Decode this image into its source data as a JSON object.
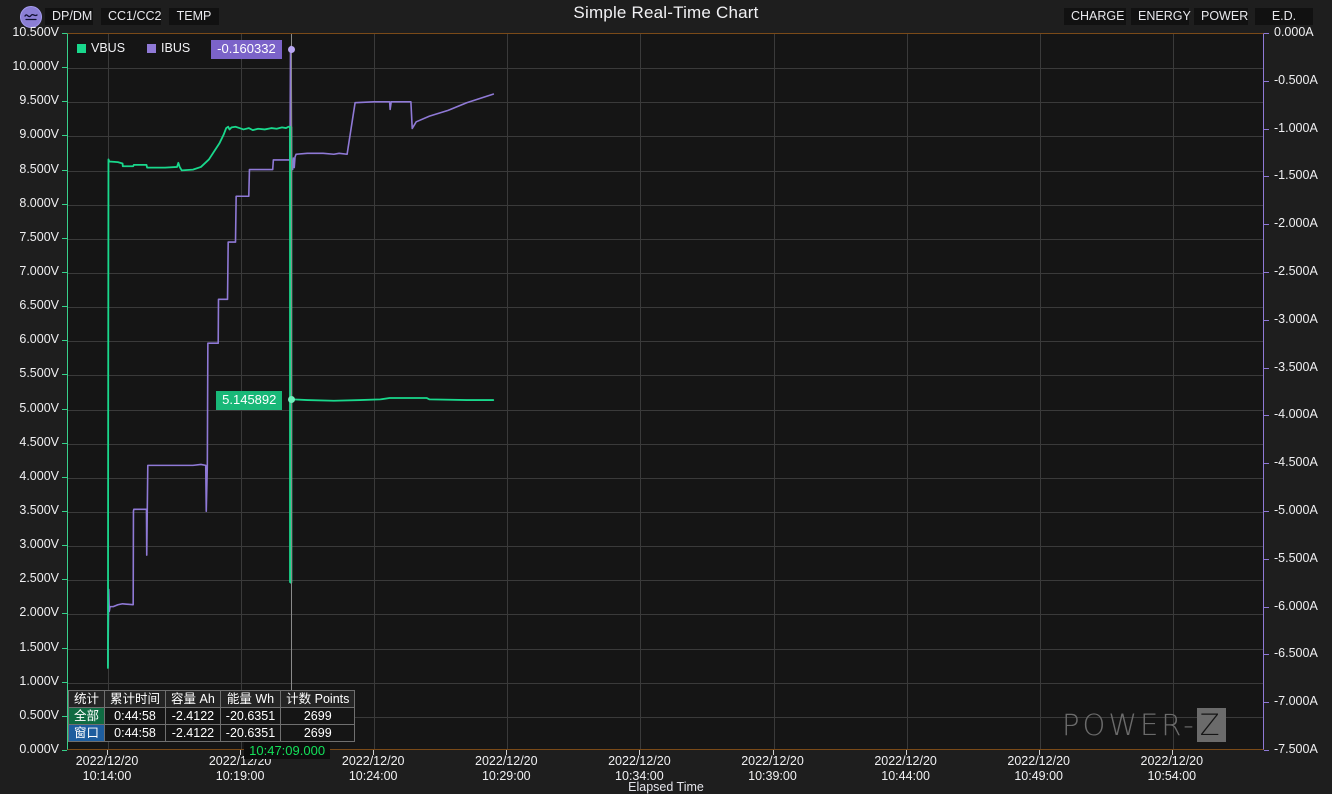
{
  "window": {
    "title": "Simple Real-Time Chart",
    "logo_icon": "power-z-wave-icon"
  },
  "toolbar": {
    "left_buttons": [
      {
        "id": "dpdm",
        "label": "DP/DM"
      },
      {
        "id": "cc",
        "label": "CC1/CC2"
      },
      {
        "id": "temp",
        "label": "TEMP"
      }
    ],
    "right_buttons": [
      {
        "id": "charge",
        "label": "CHARGE"
      },
      {
        "id": "energy",
        "label": "ENERGY"
      },
      {
        "id": "power",
        "label": "POWER"
      },
      {
        "id": "ed",
        "label": "E.D."
      }
    ]
  },
  "legend": [
    {
      "label": "VBUS",
      "color": "#19d88c"
    },
    {
      "label": "IBUS",
      "color": "#8f79d6"
    }
  ],
  "cursor": {
    "time_label": "10:47:09.000",
    "ibus_value": "-0.160332",
    "vbus_value": "5.145892"
  },
  "stats": {
    "headers": [
      "统计",
      "累计时间",
      "容量 Ah",
      "能量 Wh",
      "计数 Points"
    ],
    "rows": [
      {
        "label": "全部",
        "elapsed": "0:44:58",
        "capacity": "-2.4122",
        "energy": "-20.6351",
        "points": "2699"
      },
      {
        "label": "窗口",
        "elapsed": "0:44:58",
        "capacity": "-2.4122",
        "energy": "-20.6351",
        "points": "2699"
      }
    ]
  },
  "watermark": {
    "text_main": "POWER-",
    "text_box": "Z"
  },
  "chart_data": {
    "type": "line",
    "title": "Simple Real-Time Chart",
    "xlabel": "Elapsed Time",
    "grid": true,
    "legend_position": "top-left",
    "x_ticks": [
      "2022/12/20\n10:14:00",
      "2022/12/20\n10:19:00",
      "2022/12/20\n10:24:00",
      "2022/12/20\n10:29:00",
      "2022/12/20\n10:34:00",
      "2022/12/20\n10:39:00",
      "2022/12/20\n10:44:00",
      "2022/12/20\n10:49:00",
      "2022/12/20\n10:54:00"
    ],
    "x_tick_dates": [
      "2022/12/20",
      "2022/12/20",
      "2022/12/20",
      "2022/12/20",
      "2022/12/20",
      "2022/12/20",
      "2022/12/20",
      "2022/12/20",
      "2022/12/20"
    ],
    "x_tick_times": [
      "10:14:00",
      "10:19:00",
      "10:24:00",
      "10:29:00",
      "10:34:00",
      "10:39:00",
      "10:44:00",
      "10:49:00",
      "10:54:00"
    ],
    "axes": {
      "left": {
        "label": "VBUS",
        "unit": "V",
        "color": "#19d88c",
        "ylim": [
          0.0,
          10.5
        ],
        "tick_step": 0.5,
        "ticks": [
          "10.500V",
          "10.000V",
          "9.500V",
          "9.000V",
          "8.500V",
          "8.000V",
          "7.500V",
          "7.000V",
          "6.500V",
          "6.000V",
          "5.500V",
          "5.000V",
          "4.500V",
          "4.000V",
          "3.500V",
          "3.000V",
          "2.500V",
          "2.000V",
          "1.500V",
          "1.000V",
          "0.500V",
          "0.000V"
        ]
      },
      "right": {
        "label": "IBUS",
        "unit": "A",
        "color": "#8f79d6",
        "ylim": [
          -7.5,
          0.0
        ],
        "tick_step": 0.5,
        "ticks": [
          "0.000A",
          "-0.500A",
          "-1.000A",
          "-1.500A",
          "-2.000A",
          "-2.500A",
          "-3.000A",
          "-3.500A",
          "-4.000A",
          "-4.500A",
          "-5.000A",
          "-5.500A",
          "-6.000A",
          "-6.500A",
          "-7.000A",
          "-7.500A"
        ]
      }
    },
    "series": [
      {
        "name": "VBUS",
        "color": "#19d88c",
        "axis": "left",
        "unit": "V",
        "points": [
          [
            0.0,
            1.2
          ],
          [
            0.004,
            8.66
          ],
          [
            0.01,
            8.63
          ],
          [
            0.075,
            8.62
          ],
          [
            0.11,
            8.6
          ],
          [
            0.112,
            8.56
          ],
          [
            0.19,
            8.56
          ],
          [
            0.195,
            8.58
          ],
          [
            0.29,
            8.58
          ],
          [
            0.295,
            8.54
          ],
          [
            0.43,
            8.54
          ],
          [
            0.52,
            8.55
          ],
          [
            0.53,
            8.61
          ],
          [
            0.54,
            8.55
          ],
          [
            0.555,
            8.5
          ],
          [
            0.64,
            8.51
          ],
          [
            0.7,
            8.55
          ],
          [
            0.76,
            8.66
          ],
          [
            0.8,
            8.78
          ],
          [
            0.84,
            8.9
          ],
          [
            0.87,
            9.02
          ],
          [
            0.89,
            9.12
          ],
          [
            0.905,
            9.14
          ],
          [
            0.915,
            9.1
          ],
          [
            0.93,
            9.13
          ],
          [
            0.96,
            9.14
          ],
          [
            0.99,
            9.12
          ],
          [
            1.02,
            9.1
          ],
          [
            1.06,
            9.12
          ],
          [
            1.09,
            9.09
          ],
          [
            1.13,
            9.11
          ],
          [
            1.18,
            9.1
          ],
          [
            1.23,
            9.12
          ],
          [
            1.27,
            9.11
          ],
          [
            1.31,
            9.13
          ],
          [
            1.34,
            9.12
          ],
          [
            1.36,
            9.14
          ],
          [
            1.372,
            9.14
          ],
          [
            1.376,
            2.45
          ],
          [
            1.38,
            5.18
          ],
          [
            1.39,
            5.14
          ],
          [
            1.5,
            5.13
          ],
          [
            1.7,
            5.12
          ],
          [
            1.9,
            5.13
          ],
          [
            2.05,
            5.14
          ],
          [
            2.12,
            5.16
          ],
          [
            2.4,
            5.16
          ],
          [
            2.42,
            5.14
          ],
          [
            2.7,
            5.13
          ],
          [
            2.9,
            5.13
          ]
        ]
      },
      {
        "name": "IBUS",
        "color": "#8f79d6",
        "axis": "right",
        "unit": "A",
        "points": [
          [
            0.0,
            -6.62
          ],
          [
            0.006,
            -5.82
          ],
          [
            0.01,
            -6.05
          ],
          [
            0.016,
            -6.0
          ],
          [
            0.04,
            -6.0
          ],
          [
            0.075,
            -5.98
          ],
          [
            0.11,
            -5.97
          ],
          [
            0.19,
            -5.98
          ],
          [
            0.192,
            -5.0
          ],
          [
            0.195,
            -4.98
          ],
          [
            0.29,
            -4.98
          ],
          [
            0.292,
            -5.46
          ],
          [
            0.3,
            -4.52
          ],
          [
            0.43,
            -4.52
          ],
          [
            0.64,
            -4.52
          ],
          [
            0.7,
            -4.51
          ],
          [
            0.736,
            -4.52
          ],
          [
            0.74,
            -5.0
          ],
          [
            0.748,
            -4.52
          ],
          [
            0.752,
            -3.24
          ],
          [
            0.83,
            -3.24
          ],
          [
            0.832,
            -2.78
          ],
          [
            0.9,
            -2.78
          ],
          [
            0.905,
            -2.18
          ],
          [
            0.96,
            -2.18
          ],
          [
            0.965,
            -1.7
          ],
          [
            1.06,
            -1.7
          ],
          [
            1.065,
            -1.42
          ],
          [
            1.24,
            -1.42
          ],
          [
            1.245,
            -1.32
          ],
          [
            1.37,
            -1.32
          ],
          [
            1.374,
            -0.16
          ],
          [
            1.378,
            -0.13
          ],
          [
            1.382,
            -1.32
          ],
          [
            1.39,
            -1.42
          ],
          [
            1.396,
            -1.3
          ],
          [
            1.402,
            -1.4
          ],
          [
            1.408,
            -1.29
          ],
          [
            1.416,
            -1.26
          ],
          [
            1.5,
            -1.25
          ],
          [
            1.62,
            -1.25
          ],
          [
            1.7,
            -1.26
          ],
          [
            1.74,
            -1.25
          ],
          [
            1.8,
            -1.26
          ],
          [
            1.86,
            -0.72
          ],
          [
            2.0,
            -0.71
          ],
          [
            2.12,
            -0.71
          ],
          [
            2.124,
            -0.79
          ],
          [
            2.132,
            -0.71
          ],
          [
            2.28,
            -0.71
          ],
          [
            2.29,
            -0.99
          ],
          [
            2.32,
            -0.92
          ],
          [
            2.42,
            -0.86
          ],
          [
            2.56,
            -0.8
          ],
          [
            2.7,
            -0.72
          ],
          [
            2.9,
            -0.63
          ]
        ]
      }
    ],
    "cursor": {
      "x_label": "10:47:09.000",
      "vbus_at_cursor": 5.145892,
      "ibus_at_cursor": -0.160332
    }
  }
}
